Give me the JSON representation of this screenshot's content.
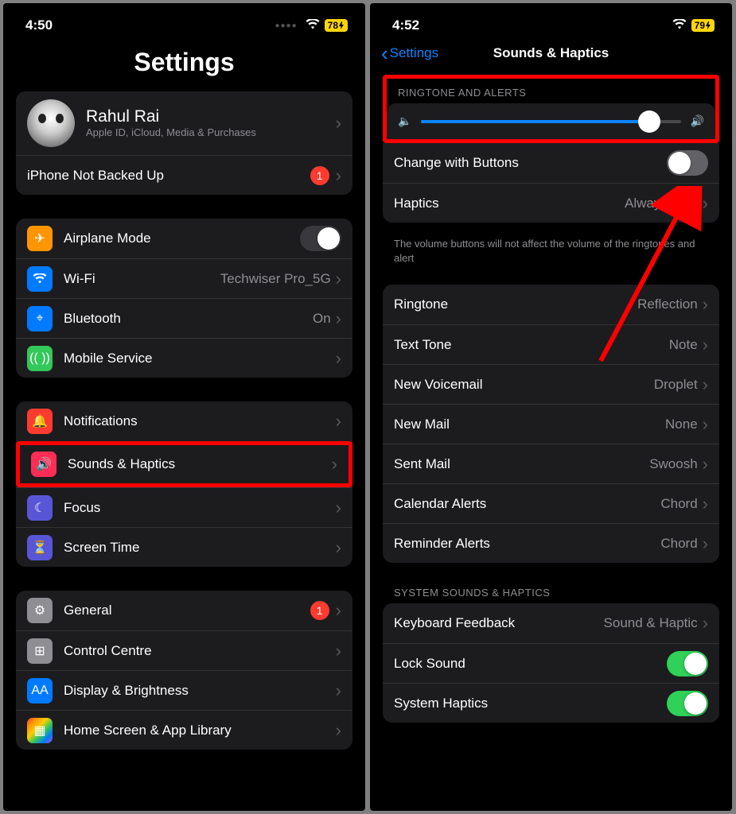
{
  "left": {
    "status": {
      "time": "4:50",
      "battery": "78"
    },
    "title": "Settings",
    "profile": {
      "name": "Rahul Rai",
      "sub": "Apple ID, iCloud, Media & Purchases",
      "backup_label": "iPhone Not Backed Up",
      "backup_badge": "1"
    },
    "conn": {
      "airplane": "Airplane Mode",
      "wifi": "Wi-Fi",
      "wifi_value": "Techwiser Pro_5G",
      "bluetooth": "Bluetooth",
      "bluetooth_value": "On",
      "mobile": "Mobile Service"
    },
    "pref": {
      "notifications": "Notifications",
      "sounds": "Sounds & Haptics",
      "focus": "Focus",
      "screentime": "Screen Time"
    },
    "sys": {
      "general": "General",
      "general_badge": "1",
      "control": "Control Centre",
      "display": "Display & Brightness",
      "home": "Home Screen & App Library"
    }
  },
  "right": {
    "status": {
      "time": "4:52",
      "battery": "79"
    },
    "back": "Settings",
    "title": "Sounds & Haptics",
    "section_ringtone": "RINGTONE AND ALERTS",
    "change_buttons": "Change with Buttons",
    "haptics": "Haptics",
    "haptics_value": "Always Play",
    "footer": "The volume buttons will not affect the volume of the ringtones and alert",
    "sounds": {
      "ringtone": "Ringtone",
      "ringtone_v": "Reflection",
      "text": "Text Tone",
      "text_v": "Note",
      "voicemail": "New Voicemail",
      "voicemail_v": "Droplet",
      "mail": "New Mail",
      "mail_v": "None",
      "sent": "Sent Mail",
      "sent_v": "Swoosh",
      "calendar": "Calendar Alerts",
      "calendar_v": "Chord",
      "reminder": "Reminder Alerts",
      "reminder_v": "Chord"
    },
    "section_system": "SYSTEM SOUNDS & HAPTICS",
    "system": {
      "keyboard": "Keyboard Feedback",
      "keyboard_v": "Sound & Haptic",
      "lock": "Lock Sound",
      "haptics": "System Haptics"
    }
  }
}
